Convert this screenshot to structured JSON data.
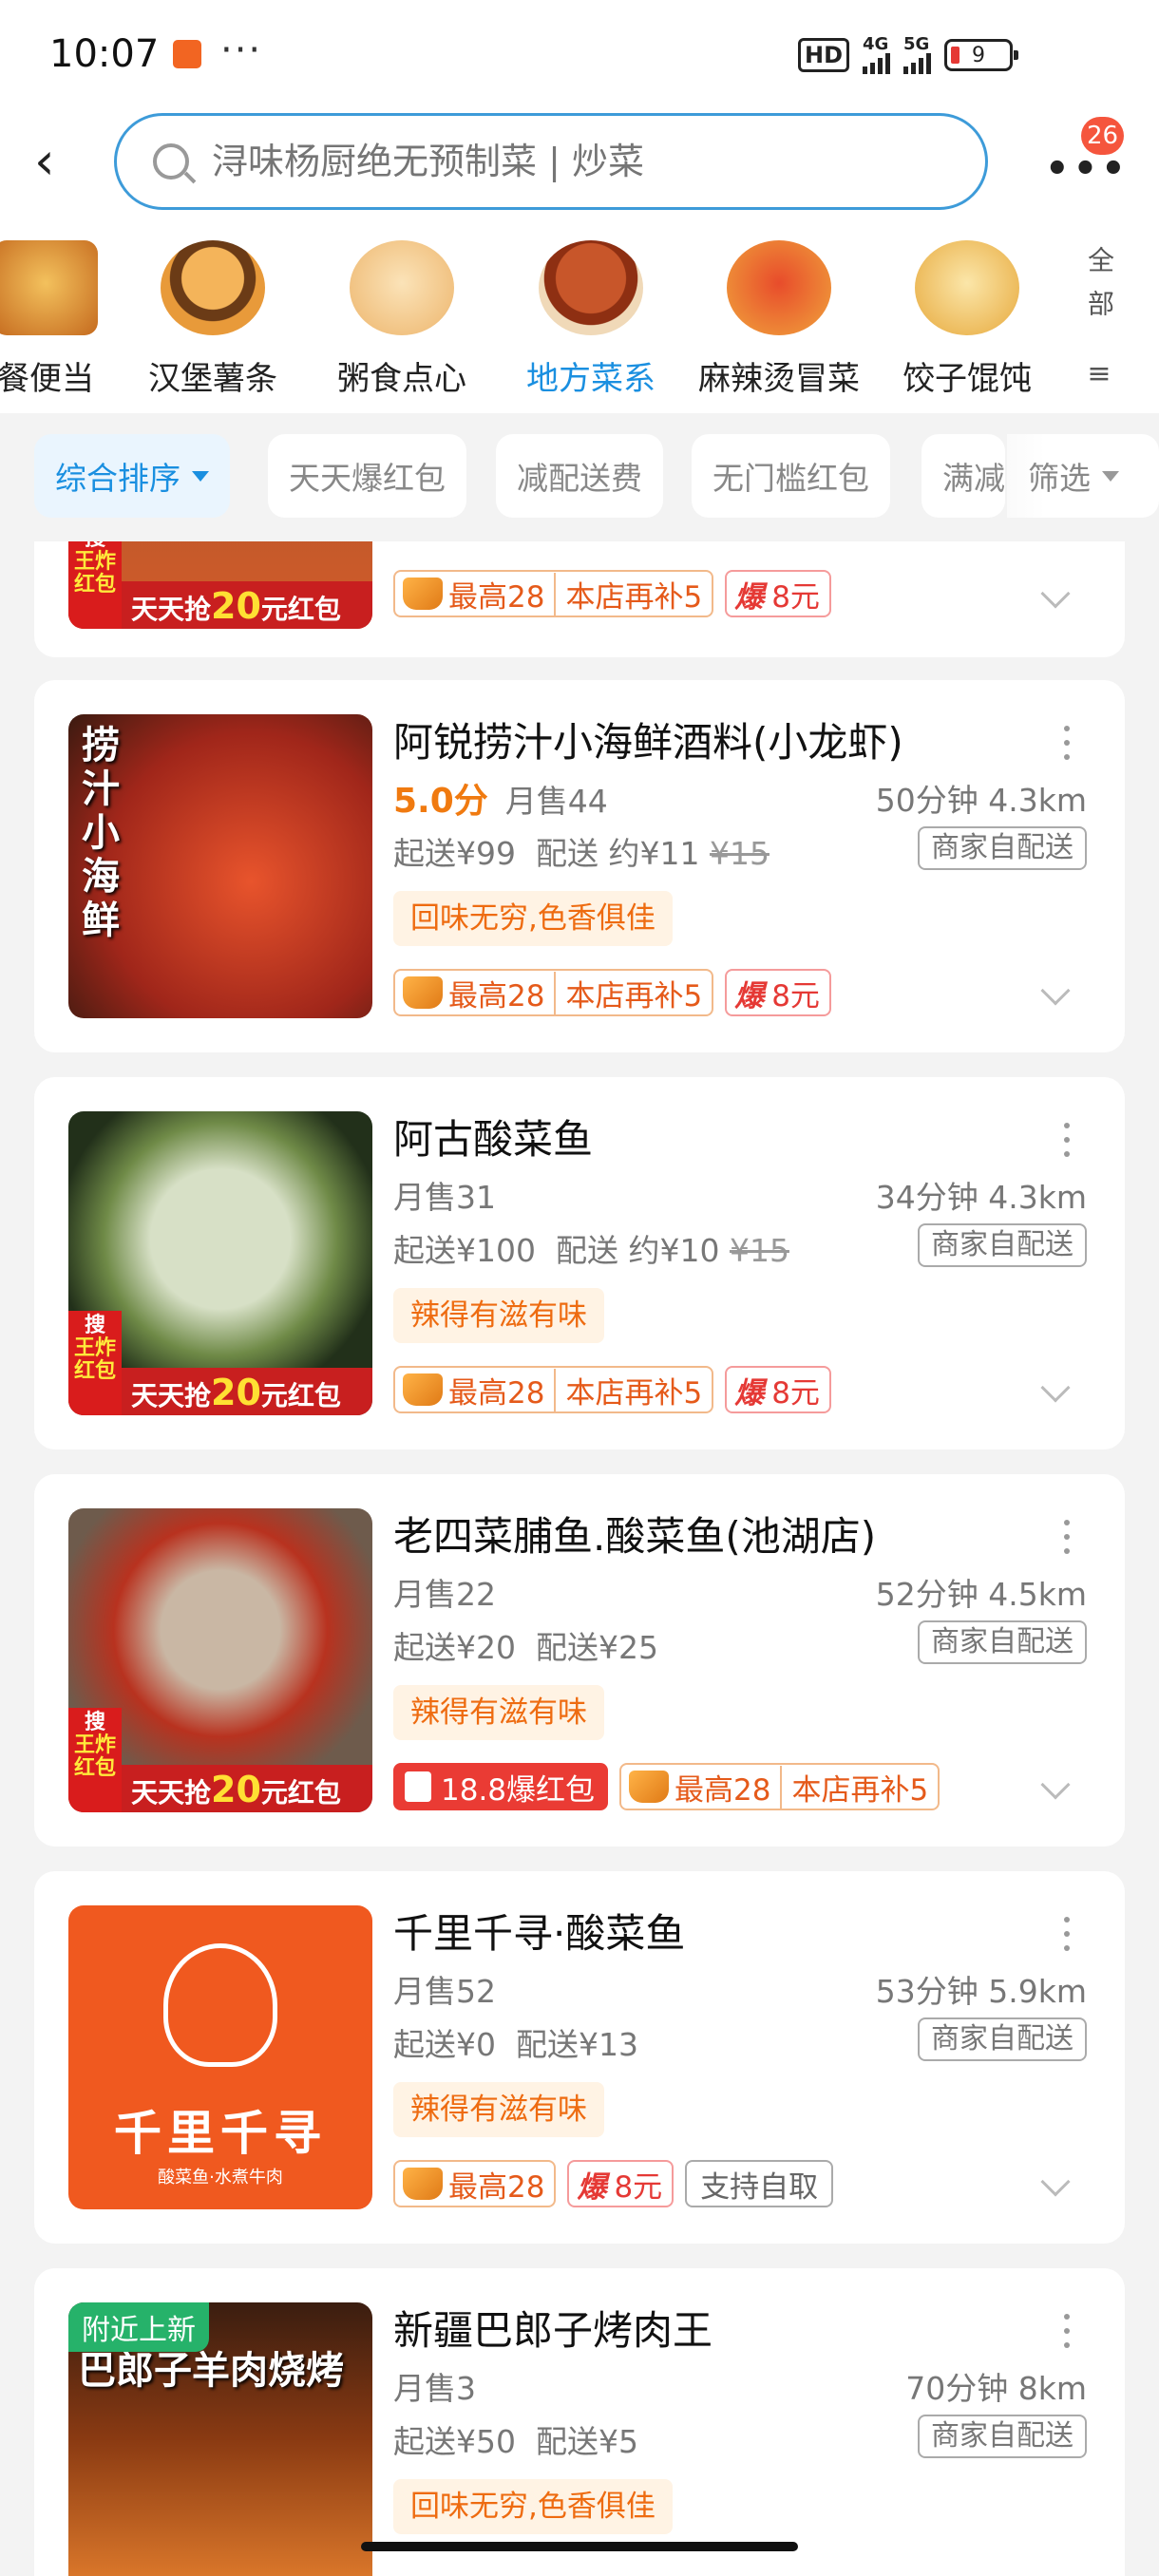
{
  "status": {
    "time": "10:07",
    "hd": "HD",
    "net1": "4G",
    "net2": "5G",
    "battery": "9"
  },
  "nav": {
    "search_placeholder": "浔味杨厨绝无预制菜 | 炒菜",
    "badge": "26"
  },
  "categories": [
    {
      "label": "餐便当",
      "active": false
    },
    {
      "label": "汉堡薯条",
      "active": false
    },
    {
      "label": "粥食点心",
      "active": false
    },
    {
      "label": "地方菜系",
      "active": true
    },
    {
      "label": "麻辣烫冒菜",
      "active": false
    },
    {
      "label": "饺子馄饨",
      "active": false
    }
  ],
  "all_label": "全部",
  "filters": [
    "综合排序",
    "天天爆红包",
    "减配送费",
    "无门槛红包",
    "满减",
    "筛选"
  ],
  "strip": {
    "sou": "搜",
    "brand": "王炸红包",
    "text": "天天抢",
    "amount": "20",
    "suffix": "元红包"
  },
  "promo": {
    "crown": "最高28",
    "extra": "本店再补5",
    "bao": "爆",
    "bao_amount": "8元",
    "red_packet": "18.8爆红包",
    "pickup": "支持自取"
  },
  "self_delivery": "商家自配送",
  "stores": [
    {
      "name": "阿锐捞汁小海鲜酒料(小龙虾)",
      "score": "5.0分",
      "sales": "月售44",
      "time_dist": "50分钟 4.3km",
      "min_order": "起送¥99",
      "delivery": "配送 约¥11",
      "orig_fee": "¥15",
      "slogan": "回味无穷,色香俱佳"
    },
    {
      "name": "阿古酸菜鱼",
      "score": "",
      "sales": "月售31",
      "time_dist": "34分钟 4.3km",
      "min_order": "起送¥100",
      "delivery": "配送 约¥10",
      "orig_fee": "¥15",
      "slogan": "辣得有滋有味"
    },
    {
      "name": "老四菜脯鱼.酸菜鱼(池湖店)",
      "score": "",
      "sales": "月售22",
      "time_dist": "52分钟 4.5km",
      "min_order": "起送¥20",
      "delivery": "配送¥25",
      "orig_fee": "",
      "slogan": "辣得有滋有味"
    },
    {
      "name": "千里千寻·酸菜鱼",
      "score": "",
      "sales": "月售52",
      "time_dist": "53分钟 5.9km",
      "min_order": "起送¥0",
      "delivery": "配送¥13",
      "orig_fee": "",
      "slogan": "辣得有滋有味",
      "logo_text": "千里千寻",
      "logo_sub": "酸菜鱼·水煮牛肉"
    },
    {
      "name": "新疆巴郎子烤肉王",
      "score": "",
      "sales": "月售3",
      "time_dist": "70分钟 8km",
      "min_order": "起送¥50",
      "delivery": "配送¥5",
      "orig_fee": "",
      "slogan": "回味无穷,色香俱佳",
      "new_tag": "附近上新",
      "pic_text": "巴郎子羊肉烧烤"
    }
  ]
}
